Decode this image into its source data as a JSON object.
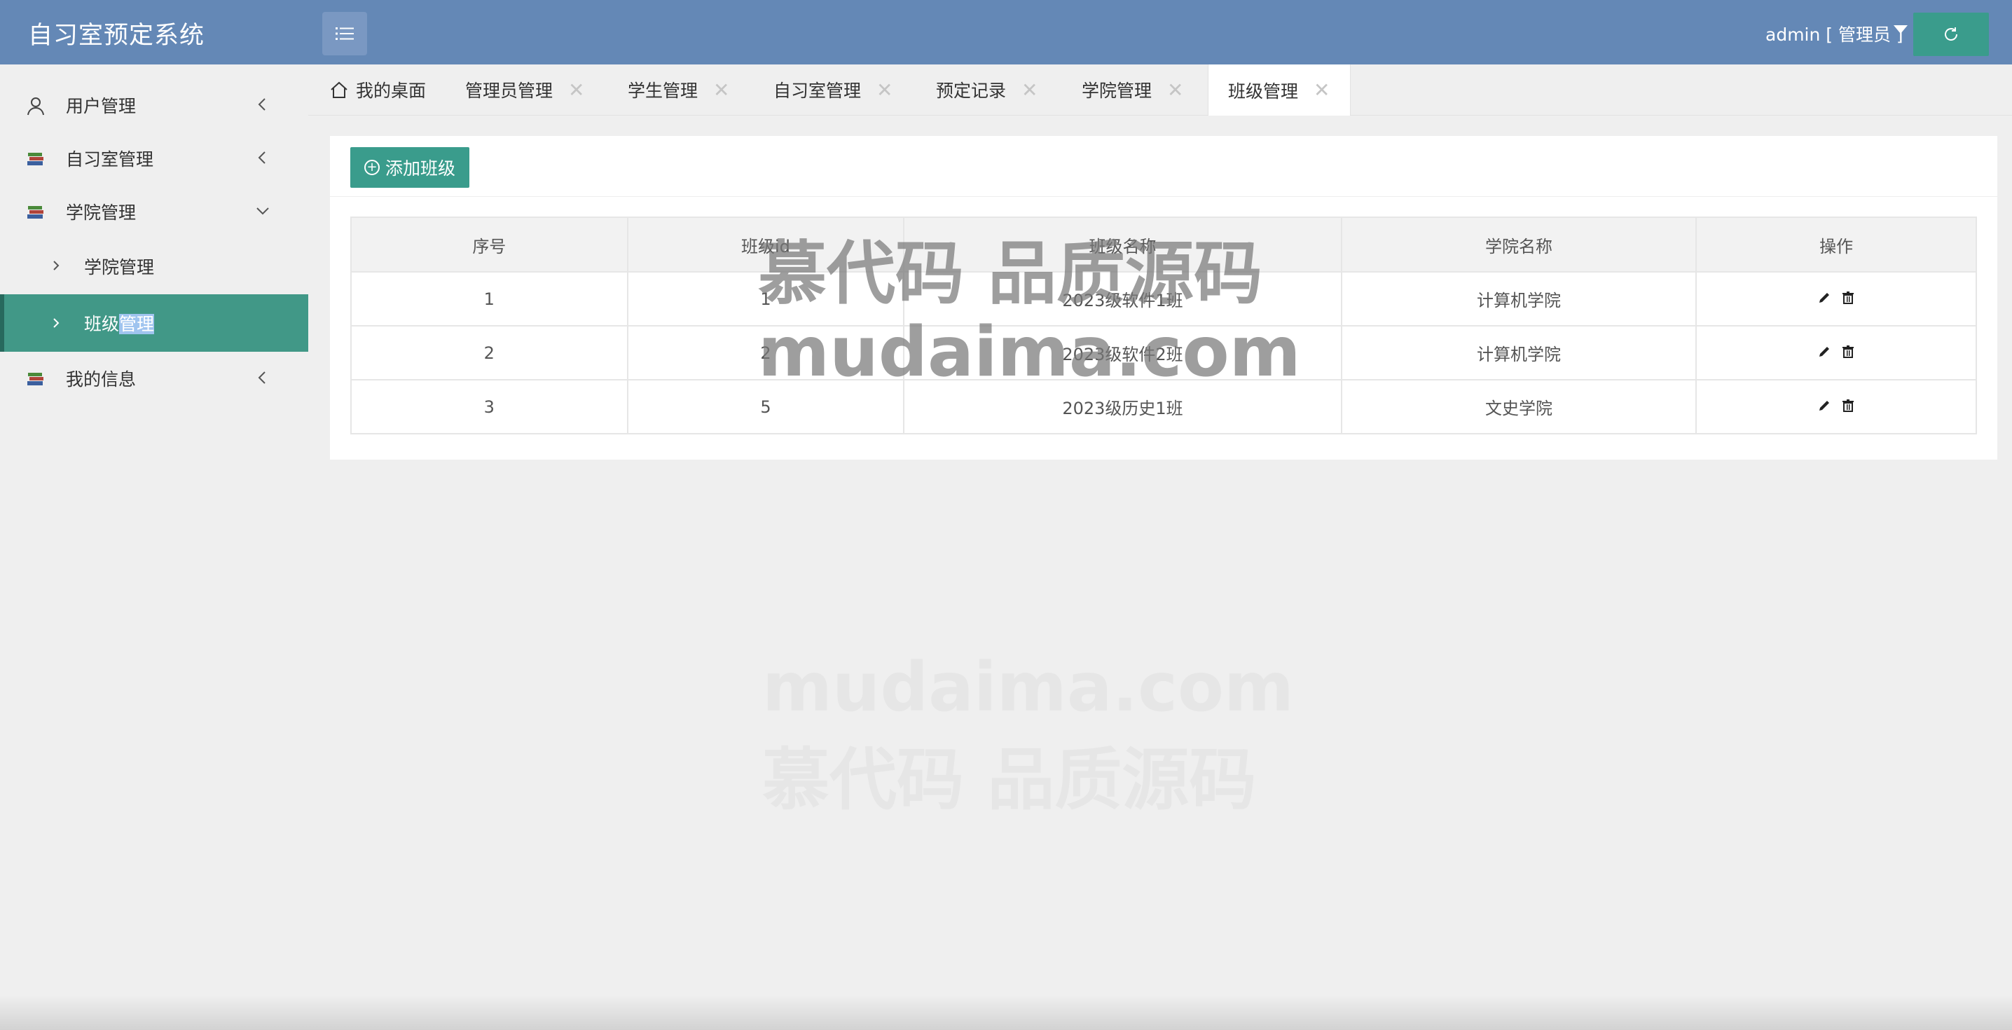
{
  "header": {
    "app_title": "自习室预定系统",
    "user_label": "admin [ 管理员 ]"
  },
  "sidebar": {
    "items": [
      {
        "label": "用户管理",
        "icon": "user-icon"
      },
      {
        "label": "自习室管理",
        "icon": "books-icon"
      },
      {
        "label": "学院管理",
        "icon": "books-icon"
      },
      {
        "label": "学院管理",
        "icon": "chevron-right-icon"
      },
      {
        "label_plain": "班级",
        "label_selected": "管理",
        "icon": "chevron-right-icon"
      },
      {
        "label": "我的信息",
        "icon": "books-icon"
      }
    ]
  },
  "tabs": [
    {
      "label": "我的桌面"
    },
    {
      "label": "管理员管理"
    },
    {
      "label": "学生管理"
    },
    {
      "label": "自习室管理"
    },
    {
      "label": "预定记录"
    },
    {
      "label": "学院管理"
    },
    {
      "label": "班级管理"
    }
  ],
  "toolbar": {
    "add_label": "添加班级"
  },
  "table": {
    "headers": [
      "序号",
      "班级id",
      "班级名称",
      "学院名称",
      "操作"
    ],
    "rows": [
      [
        "1",
        "1",
        "2023级软件1班",
        "计算机学院"
      ],
      [
        "2",
        "2",
        "2023级软件2班",
        "计算机学院"
      ],
      [
        "3",
        "5",
        "2023级历史1班",
        "文史学院"
      ]
    ]
  },
  "watermark": {
    "line1": "慕代码 品质源码",
    "line2": "mudaima.com"
  },
  "colors": {
    "header": "#6488b6",
    "accent": "#3a9c8c",
    "active_nav": "#419887"
  }
}
